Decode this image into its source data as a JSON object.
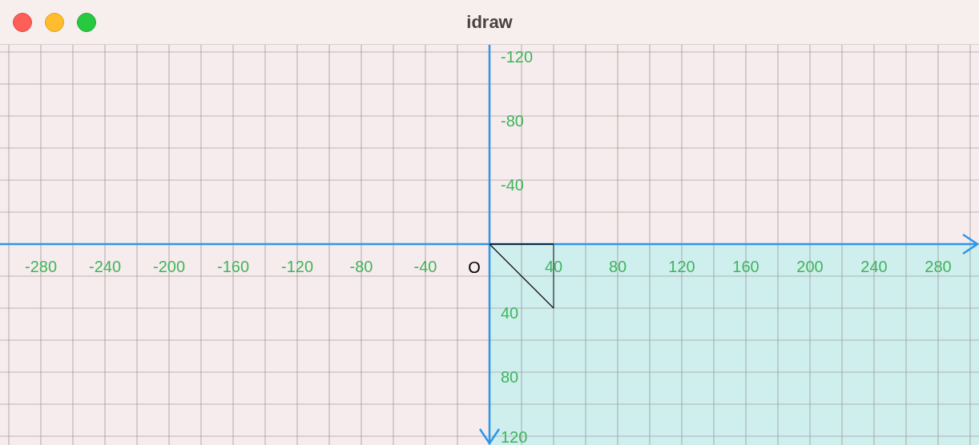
{
  "window": {
    "title": "idraw"
  },
  "x_axis": {
    "negative_labels": [
      "-280",
      "-240",
      "-200",
      "-160",
      "-120",
      "-80",
      "-40"
    ],
    "positive_labels": [
      "40",
      "80",
      "120",
      "160",
      "200",
      "240",
      "280"
    ]
  },
  "y_axis": {
    "negative_labels": [
      "-120",
      "-80",
      "-40"
    ],
    "positive_labels": [
      "40",
      "80",
      "120"
    ]
  },
  "origin_label": "O"
}
